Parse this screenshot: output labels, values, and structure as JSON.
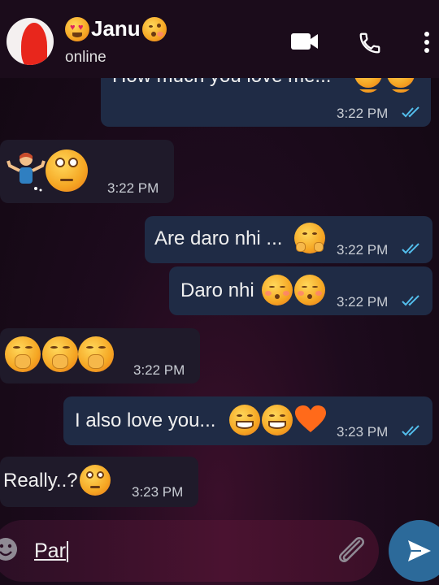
{
  "header": {
    "contact_name": "Janu",
    "status": "online"
  },
  "messages": [
    {
      "text": "How much you love me...",
      "time": "3:22 PM",
      "direction": "outgoing",
      "read": true
    },
    {
      "text": "",
      "time": "3:22 PM",
      "direction": "incoming"
    },
    {
      "text": "Are daro nhi ...",
      "time": "3:22 PM",
      "direction": "outgoing",
      "read": true
    },
    {
      "text": "Daro nhi",
      "time": "3:22 PM",
      "direction": "outgoing",
      "read": true
    },
    {
      "text": "",
      "time": "3:22 PM",
      "direction": "incoming"
    },
    {
      "text": "I also love you...",
      "time": "3:23 PM",
      "direction": "outgoing",
      "read": true
    },
    {
      "text": "Really..?",
      "time": "3:23 PM",
      "direction": "incoming"
    }
  ],
  "composer": {
    "value": "Par"
  },
  "icons": {
    "video_call": "video-camera-icon",
    "voice_call": "phone-icon",
    "menu": "more-vert-icon",
    "emoji": "emoji-icon",
    "attach": "paperclip-icon",
    "send": "send-icon"
  },
  "colors": {
    "outgoing_bubble": "#1f2b45",
    "incoming_bubble": "#1f1a2a",
    "read_ticks": "#53bdeb",
    "send_button": "#2c6a9a"
  }
}
